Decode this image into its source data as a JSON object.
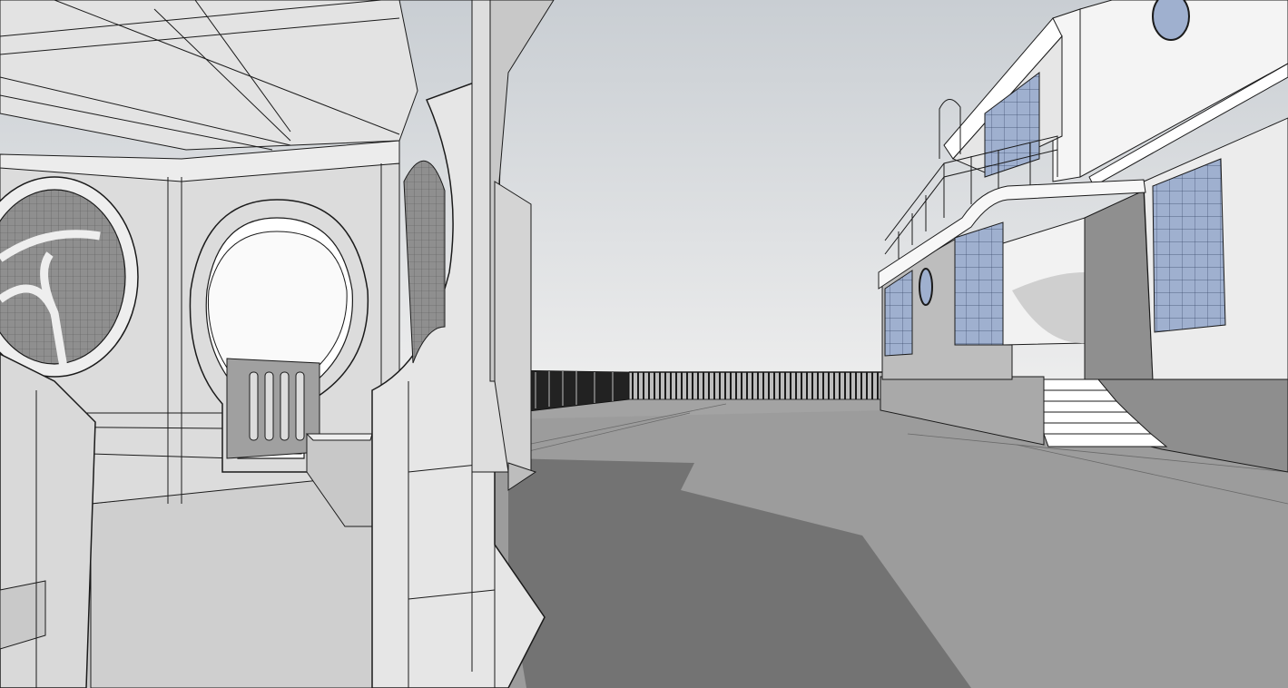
{
  "scene": {
    "kind": "sketch-style 3D architectural model viewport",
    "objects": [
      "pavilion",
      "moon-gate",
      "fence",
      "terrace",
      "villa",
      "entrance-steps",
      "round-windows",
      "glass-windows",
      "roof-railing"
    ],
    "style": "hidden-line edges with monochrome shading"
  },
  "colors": {
    "sky_top": "#c9ced3",
    "sky_bottom": "#eeeeee",
    "ground": "#9c9c9c",
    "shadow": "#737373",
    "wall_light": "#ececec",
    "wall_mid": "#d4d4d4",
    "wall_dark": "#a9a9a9",
    "glass": "#9fb0cf",
    "edge": "#1b1b1b"
  }
}
